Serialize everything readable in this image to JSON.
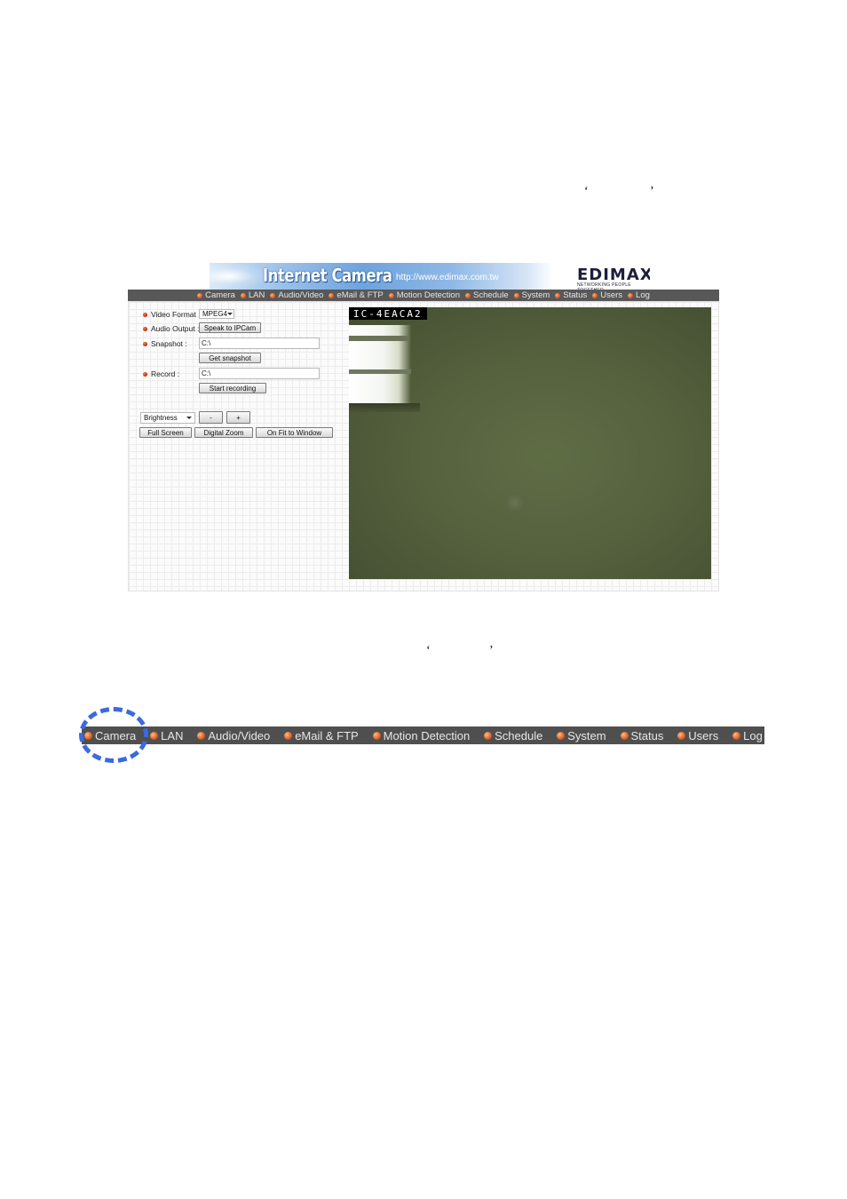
{
  "doc": {
    "quote_open": "‘",
    "quote_close": "’"
  },
  "banner": {
    "title": "Internet Camera",
    "url": "http://www.edimax.com.tw",
    "logo": "EDIMAX",
    "tagline": "NETWORKING PEOPLE TOGETHER"
  },
  "nav": {
    "items": [
      "Camera",
      "LAN",
      "Audio/Video",
      "eMail & FTP",
      "Motion Detection",
      "Schedule",
      "System",
      "Status",
      "Users",
      "Log"
    ]
  },
  "controls": {
    "video_format_label": "Video Format :",
    "video_format_value": "MPEG4",
    "audio_output_label": "Audio Output :",
    "speak_button": "Speak to IPCam",
    "snapshot_label": "Snapshot :",
    "snapshot_path": "C:\\",
    "get_snapshot_button": "Get snapshot",
    "record_label": "Record :",
    "record_path": "C:\\",
    "start_recording_button": "Start recording",
    "adjust_select": "Brightness",
    "minus_button": "-",
    "plus_button": "+",
    "full_screen_button": "Full Screen",
    "digital_zoom_button": "Digital Zoom",
    "fit_window_button": "On Fit to Window"
  },
  "video": {
    "camera_id": "IC-4EACA2"
  },
  "colors": {
    "nav_bg": "#585858",
    "nav_dot": "#d4501a",
    "highlight": "#3b6ae0"
  }
}
